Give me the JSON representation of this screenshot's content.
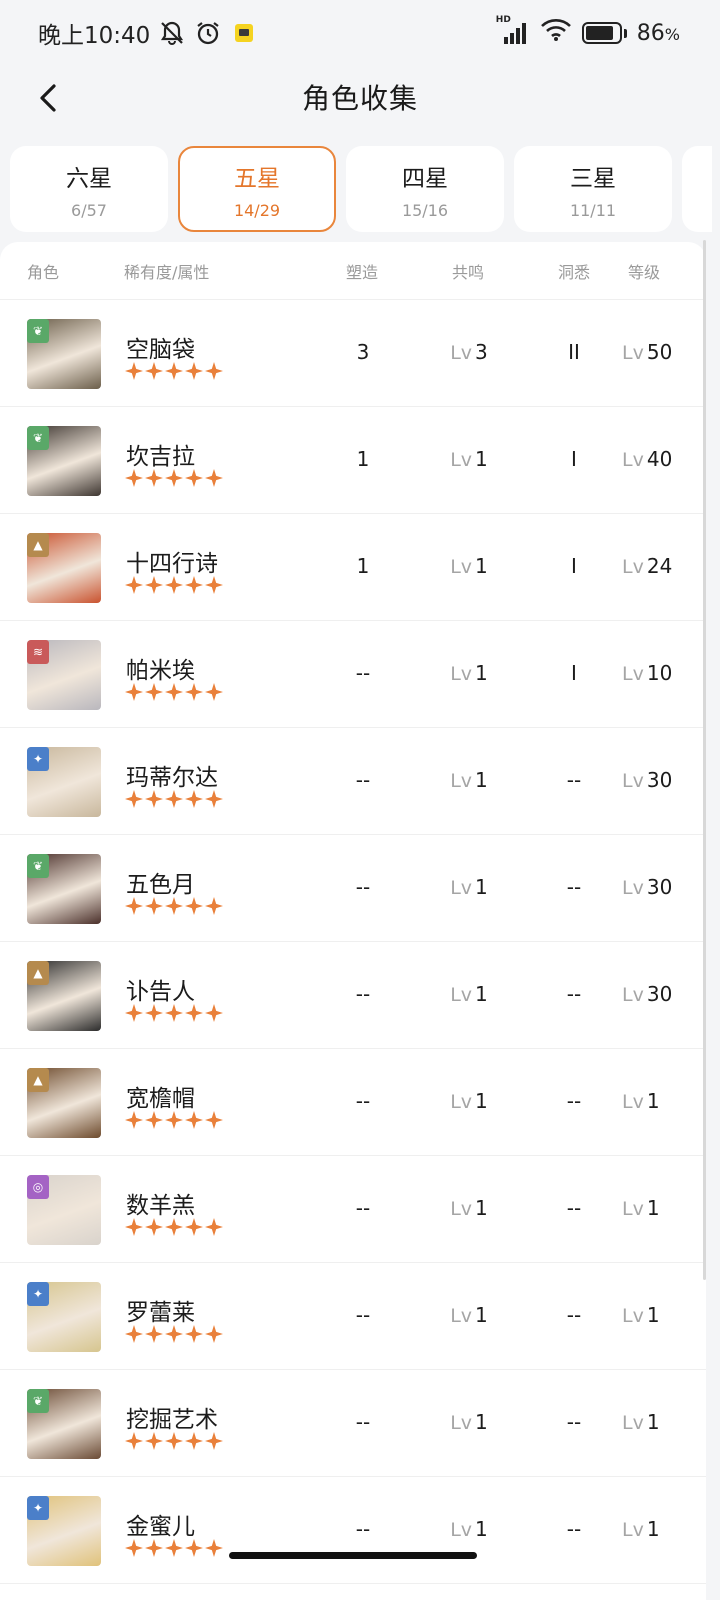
{
  "status_bar": {
    "time": "晚上10:40",
    "network_label": "HD",
    "battery_pct": "86",
    "battery_unit": "%",
    "icons": [
      "mute-icon",
      "alarm-icon",
      "app-notification-icon",
      "signal-icon",
      "wifi-icon",
      "battery-icon"
    ]
  },
  "header": {
    "title": "角色收集"
  },
  "tabs": [
    {
      "title": "六星",
      "count": "6/57",
      "active": false
    },
    {
      "title": "五星",
      "count": "14/29",
      "active": true
    },
    {
      "title": "四星",
      "count": "15/16",
      "active": false
    },
    {
      "title": "三星",
      "count": "11/11",
      "active": false
    }
  ],
  "columns": {
    "role": "角色",
    "rarity": "稀有度/属性",
    "suzao": "塑造",
    "gongming": "共鸣",
    "dongxi": "洞悉",
    "level": "等级"
  },
  "lv_prefix": "Lv",
  "stars_per_row": 5,
  "colors": {
    "accent": "#e4762b",
    "star": "#e9803a",
    "element_green": "#5aa868",
    "element_gold": "#b58a4e",
    "element_red": "#c95a5a",
    "element_blue": "#4b7fc9",
    "element_purple": "#a463c4"
  },
  "characters": [
    {
      "name": "空脑袋",
      "element": "plant",
      "suzao": "3",
      "gongming": "3",
      "dongxi": "II",
      "level": "50",
      "avatar_color": "#6b5e4a"
    },
    {
      "name": "坎吉拉",
      "element": "plant",
      "suzao": "1",
      "gongming": "1",
      "dongxi": "I",
      "level": "40",
      "avatar_color": "#3d3530"
    },
    {
      "name": "十四行诗",
      "element": "mineral",
      "suzao": "1",
      "gongming": "1",
      "dongxi": "I",
      "level": "24",
      "avatar_color": "#c9522e"
    },
    {
      "name": "帕米埃",
      "element": "beast",
      "suzao": "--",
      "gongming": "1",
      "dongxi": "I",
      "level": "10",
      "avatar_color": "#b9b7bd"
    },
    {
      "name": "玛蒂尔达",
      "element": "star",
      "suzao": "--",
      "gongming": "1",
      "dongxi": "--",
      "level": "30",
      "avatar_color": "#c8b79c"
    },
    {
      "name": "五色月",
      "element": "plant",
      "suzao": "--",
      "gongming": "1",
      "dongxi": "--",
      "level": "30",
      "avatar_color": "#4a2f2a"
    },
    {
      "name": "讣告人",
      "element": "mineral",
      "suzao": "--",
      "gongming": "1",
      "dongxi": "--",
      "level": "30",
      "avatar_color": "#2b2b2b"
    },
    {
      "name": "宽檐帽",
      "element": "mineral",
      "suzao": "--",
      "gongming": "1",
      "dongxi": "--",
      "level": "1",
      "avatar_color": "#6d4a2c"
    },
    {
      "name": "数羊羔",
      "element": "spirit",
      "suzao": "--",
      "gongming": "1",
      "dongxi": "--",
      "level": "1",
      "avatar_color": "#d9d3cc"
    },
    {
      "name": "罗蕾莱",
      "element": "star",
      "suzao": "--",
      "gongming": "1",
      "dongxi": "--",
      "level": "1",
      "avatar_color": "#d6c58e"
    },
    {
      "name": "挖掘艺术",
      "element": "plant",
      "suzao": "--",
      "gongming": "1",
      "dongxi": "--",
      "level": "1",
      "avatar_color": "#6a4a34"
    },
    {
      "name": "金蜜儿",
      "element": "star",
      "suzao": "--",
      "gongming": "1",
      "dongxi": "--",
      "level": "1",
      "avatar_color": "#e0c27a"
    }
  ]
}
